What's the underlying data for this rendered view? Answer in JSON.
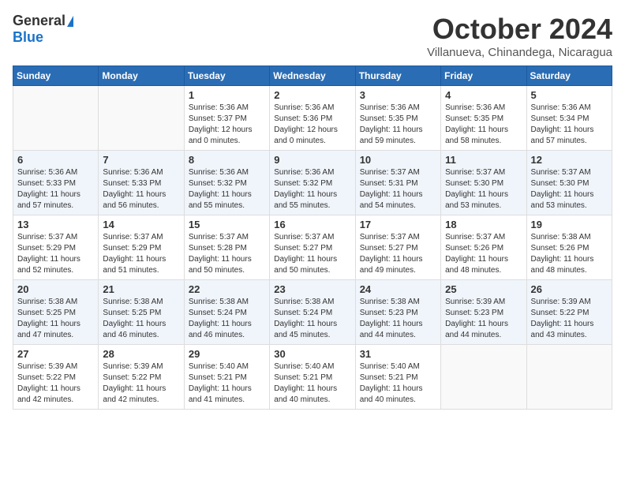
{
  "header": {
    "logo_general": "General",
    "logo_blue": "Blue",
    "month_title": "October 2024",
    "location": "Villanueva, Chinandega, Nicaragua"
  },
  "weekdays": [
    "Sunday",
    "Monday",
    "Tuesday",
    "Wednesday",
    "Thursday",
    "Friday",
    "Saturday"
  ],
  "weeks": [
    [
      {
        "day": "",
        "detail": ""
      },
      {
        "day": "",
        "detail": ""
      },
      {
        "day": "1",
        "detail": "Sunrise: 5:36 AM\nSunset: 5:37 PM\nDaylight: 12 hours\nand 0 minutes."
      },
      {
        "day": "2",
        "detail": "Sunrise: 5:36 AM\nSunset: 5:36 PM\nDaylight: 12 hours\nand 0 minutes."
      },
      {
        "day": "3",
        "detail": "Sunrise: 5:36 AM\nSunset: 5:35 PM\nDaylight: 11 hours\nand 59 minutes."
      },
      {
        "day": "4",
        "detail": "Sunrise: 5:36 AM\nSunset: 5:35 PM\nDaylight: 11 hours\nand 58 minutes."
      },
      {
        "day": "5",
        "detail": "Sunrise: 5:36 AM\nSunset: 5:34 PM\nDaylight: 11 hours\nand 57 minutes."
      }
    ],
    [
      {
        "day": "6",
        "detail": "Sunrise: 5:36 AM\nSunset: 5:33 PM\nDaylight: 11 hours\nand 57 minutes."
      },
      {
        "day": "7",
        "detail": "Sunrise: 5:36 AM\nSunset: 5:33 PM\nDaylight: 11 hours\nand 56 minutes."
      },
      {
        "day": "8",
        "detail": "Sunrise: 5:36 AM\nSunset: 5:32 PM\nDaylight: 11 hours\nand 55 minutes."
      },
      {
        "day": "9",
        "detail": "Sunrise: 5:36 AM\nSunset: 5:32 PM\nDaylight: 11 hours\nand 55 minutes."
      },
      {
        "day": "10",
        "detail": "Sunrise: 5:37 AM\nSunset: 5:31 PM\nDaylight: 11 hours\nand 54 minutes."
      },
      {
        "day": "11",
        "detail": "Sunrise: 5:37 AM\nSunset: 5:30 PM\nDaylight: 11 hours\nand 53 minutes."
      },
      {
        "day": "12",
        "detail": "Sunrise: 5:37 AM\nSunset: 5:30 PM\nDaylight: 11 hours\nand 53 minutes."
      }
    ],
    [
      {
        "day": "13",
        "detail": "Sunrise: 5:37 AM\nSunset: 5:29 PM\nDaylight: 11 hours\nand 52 minutes."
      },
      {
        "day": "14",
        "detail": "Sunrise: 5:37 AM\nSunset: 5:29 PM\nDaylight: 11 hours\nand 51 minutes."
      },
      {
        "day": "15",
        "detail": "Sunrise: 5:37 AM\nSunset: 5:28 PM\nDaylight: 11 hours\nand 50 minutes."
      },
      {
        "day": "16",
        "detail": "Sunrise: 5:37 AM\nSunset: 5:27 PM\nDaylight: 11 hours\nand 50 minutes."
      },
      {
        "day": "17",
        "detail": "Sunrise: 5:37 AM\nSunset: 5:27 PM\nDaylight: 11 hours\nand 49 minutes."
      },
      {
        "day": "18",
        "detail": "Sunrise: 5:37 AM\nSunset: 5:26 PM\nDaylight: 11 hours\nand 48 minutes."
      },
      {
        "day": "19",
        "detail": "Sunrise: 5:38 AM\nSunset: 5:26 PM\nDaylight: 11 hours\nand 48 minutes."
      }
    ],
    [
      {
        "day": "20",
        "detail": "Sunrise: 5:38 AM\nSunset: 5:25 PM\nDaylight: 11 hours\nand 47 minutes."
      },
      {
        "day": "21",
        "detail": "Sunrise: 5:38 AM\nSunset: 5:25 PM\nDaylight: 11 hours\nand 46 minutes."
      },
      {
        "day": "22",
        "detail": "Sunrise: 5:38 AM\nSunset: 5:24 PM\nDaylight: 11 hours\nand 46 minutes."
      },
      {
        "day": "23",
        "detail": "Sunrise: 5:38 AM\nSunset: 5:24 PM\nDaylight: 11 hours\nand 45 minutes."
      },
      {
        "day": "24",
        "detail": "Sunrise: 5:38 AM\nSunset: 5:23 PM\nDaylight: 11 hours\nand 44 minutes."
      },
      {
        "day": "25",
        "detail": "Sunrise: 5:39 AM\nSunset: 5:23 PM\nDaylight: 11 hours\nand 44 minutes."
      },
      {
        "day": "26",
        "detail": "Sunrise: 5:39 AM\nSunset: 5:22 PM\nDaylight: 11 hours\nand 43 minutes."
      }
    ],
    [
      {
        "day": "27",
        "detail": "Sunrise: 5:39 AM\nSunset: 5:22 PM\nDaylight: 11 hours\nand 42 minutes."
      },
      {
        "day": "28",
        "detail": "Sunrise: 5:39 AM\nSunset: 5:22 PM\nDaylight: 11 hours\nand 42 minutes."
      },
      {
        "day": "29",
        "detail": "Sunrise: 5:40 AM\nSunset: 5:21 PM\nDaylight: 11 hours\nand 41 minutes."
      },
      {
        "day": "30",
        "detail": "Sunrise: 5:40 AM\nSunset: 5:21 PM\nDaylight: 11 hours\nand 40 minutes."
      },
      {
        "day": "31",
        "detail": "Sunrise: 5:40 AM\nSunset: 5:21 PM\nDaylight: 11 hours\nand 40 minutes."
      },
      {
        "day": "",
        "detail": ""
      },
      {
        "day": "",
        "detail": ""
      }
    ]
  ]
}
